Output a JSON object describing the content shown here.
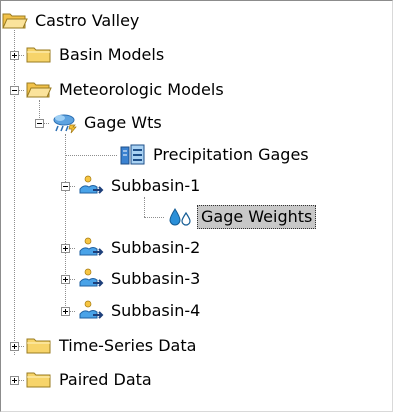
{
  "tree": {
    "root": {
      "label": "Castro Valley",
      "icon": "folder-open-icon"
    },
    "basin_models": {
      "label": "Basin Models",
      "icon": "folder-icon"
    },
    "meteorologic_models": {
      "label": "Meteorologic Models",
      "icon": "folder-open-icon"
    },
    "gage_wts": {
      "label": "Gage Wts",
      "icon": "meteorologic-model-icon"
    },
    "precipitation_gages": {
      "label": "Precipitation Gages",
      "icon": "precipitation-gages-icon"
    },
    "subbasin_1": {
      "label": "Subbasin-1",
      "icon": "subbasin-icon"
    },
    "gage_weights": {
      "label": "Gage Weights",
      "icon": "water-drops-icon",
      "selected": true
    },
    "subbasin_2": {
      "label": "Subbasin-2",
      "icon": "subbasin-icon"
    },
    "subbasin_3": {
      "label": "Subbasin-3",
      "icon": "subbasin-icon"
    },
    "subbasin_4": {
      "label": "Subbasin-4",
      "icon": "subbasin-icon"
    },
    "time_series_data": {
      "label": "Time-Series Data",
      "icon": "folder-icon"
    },
    "paired_data": {
      "label": "Paired Data",
      "icon": "folder-icon"
    }
  },
  "colors": {
    "folder": "#f7d46a",
    "selection": "#c8c8c8",
    "drop": "#2a8fd8",
    "gage": "#2b6fb3"
  }
}
